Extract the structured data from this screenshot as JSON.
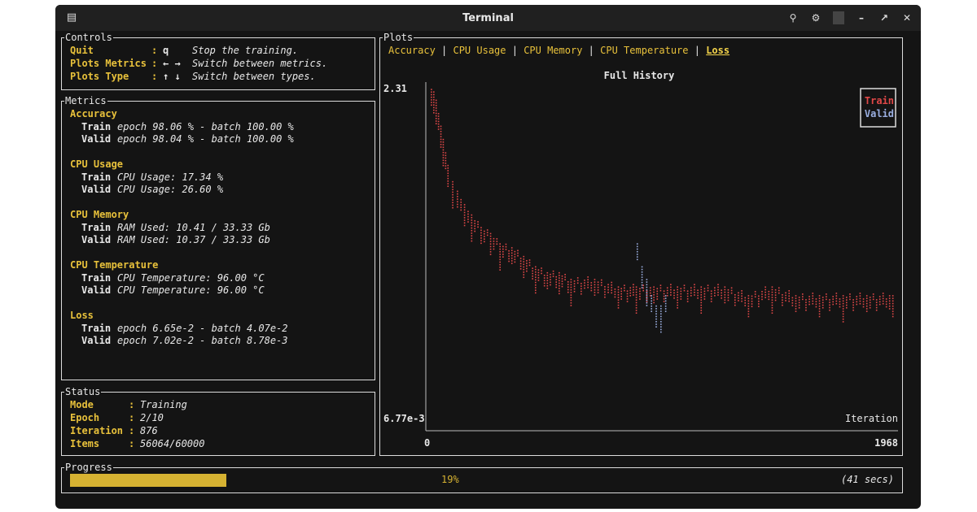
{
  "window": {
    "title": "Terminal"
  },
  "controls": {
    "title": "Controls",
    "rows": [
      {
        "key": "Quit",
        "sep": ":",
        "value": "q",
        "desc": "Stop the training."
      },
      {
        "key": "Plots Metrics",
        "sep": ":",
        "value": "← →",
        "desc": "Switch between metrics."
      },
      {
        "key": "Plots Type",
        "sep": ":",
        "value": "↑ ↓",
        "desc": "Switch between types."
      }
    ]
  },
  "metrics": {
    "title": "Metrics",
    "groups": [
      {
        "name": "Accuracy",
        "train": "epoch 98.06 % - batch 100.00 %",
        "valid": "epoch 98.04 % - batch 100.00 %"
      },
      {
        "name": "CPU Usage",
        "train": "CPU Usage: 17.34 %",
        "valid": "CPU Usage: 26.60 %"
      },
      {
        "name": "CPU Memory",
        "train": "RAM Used: 10.41 / 33.33 Gb",
        "valid": "RAM Used: 10.37 / 33.33 Gb"
      },
      {
        "name": "CPU Temperature",
        "train": "CPU Temperature: 96.00 °C",
        "valid": "CPU Temperature: 96.00 °C"
      },
      {
        "name": "Loss",
        "train": "epoch 6.65e-2 - batch 4.07e-2",
        "valid": "epoch 7.02e-2 - batch 8.78e-3"
      }
    ],
    "train_label": "Train",
    "valid_label": "Valid"
  },
  "status": {
    "title": "Status",
    "rows": [
      {
        "key": "Mode",
        "value": "Training"
      },
      {
        "key": "Epoch",
        "value": "2/10"
      },
      {
        "key": "Iteration",
        "value": "876"
      },
      {
        "key": "Items",
        "value": "56064/60000"
      }
    ]
  },
  "plots": {
    "title": "Plots",
    "tabs": [
      "Accuracy",
      "CPU Usage",
      "CPU Memory",
      "CPU Temperature",
      "Loss"
    ],
    "active_tab": "Loss",
    "chart_title": "Full History",
    "y_max_label": "2.31",
    "y_min_label": "6.77e-3",
    "x_min_label": "0",
    "x_max_label": "1968",
    "x_axis_label": "Iteration",
    "legend": [
      {
        "name": "Train",
        "color": "#e04848"
      },
      {
        "name": "Valid",
        "color": "#9aaee0"
      }
    ]
  },
  "chart_data": {
    "type": "scatter",
    "title": "Full History",
    "xlabel": "Iteration",
    "xlim": [
      0,
      1968
    ],
    "ylim": [
      0.00677,
      2.31
    ],
    "series": [
      {
        "name": "Train",
        "color": "#e04848",
        "points": [
          [
            10,
            2.3
          ],
          [
            20,
            2.2
          ],
          [
            30,
            1.9
          ],
          [
            40,
            1.5
          ],
          [
            50,
            1.2
          ],
          [
            60,
            0.95
          ],
          [
            70,
            0.75
          ],
          [
            80,
            0.6
          ],
          [
            100,
            0.45
          ],
          [
            120,
            0.38
          ],
          [
            150,
            0.3
          ],
          [
            180,
            0.25
          ],
          [
            220,
            0.2
          ],
          [
            260,
            0.18
          ],
          [
            300,
            0.15
          ],
          [
            350,
            0.14
          ],
          [
            400,
            0.12
          ],
          [
            450,
            0.1
          ],
          [
            500,
            0.09
          ],
          [
            550,
            0.09
          ],
          [
            600,
            0.08
          ],
          [
            700,
            0.08
          ],
          [
            800,
            0.07
          ],
          [
            876,
            0.07
          ],
          [
            950,
            0.07
          ],
          [
            1050,
            0.07
          ],
          [
            1150,
            0.07
          ],
          [
            1250,
            0.07
          ],
          [
            1350,
            0.06
          ],
          [
            1450,
            0.07
          ],
          [
            1550,
            0.06
          ],
          [
            1650,
            0.06
          ],
          [
            1750,
            0.06
          ],
          [
            1850,
            0.06
          ],
          [
            1960,
            0.06
          ]
        ]
      },
      {
        "name": "Valid",
        "color": "#9aaee0",
        "points": [
          [
            880,
            0.15
          ],
          [
            900,
            0.1
          ],
          [
            920,
            0.08
          ],
          [
            940,
            0.06
          ],
          [
            960,
            0.05
          ],
          [
            980,
            0.05
          ],
          [
            1000,
            0.06
          ]
        ]
      }
    ]
  },
  "progress": {
    "title": "Progress",
    "fraction": 0.19,
    "percent_label": "19%",
    "time_label": "(41 secs)"
  }
}
